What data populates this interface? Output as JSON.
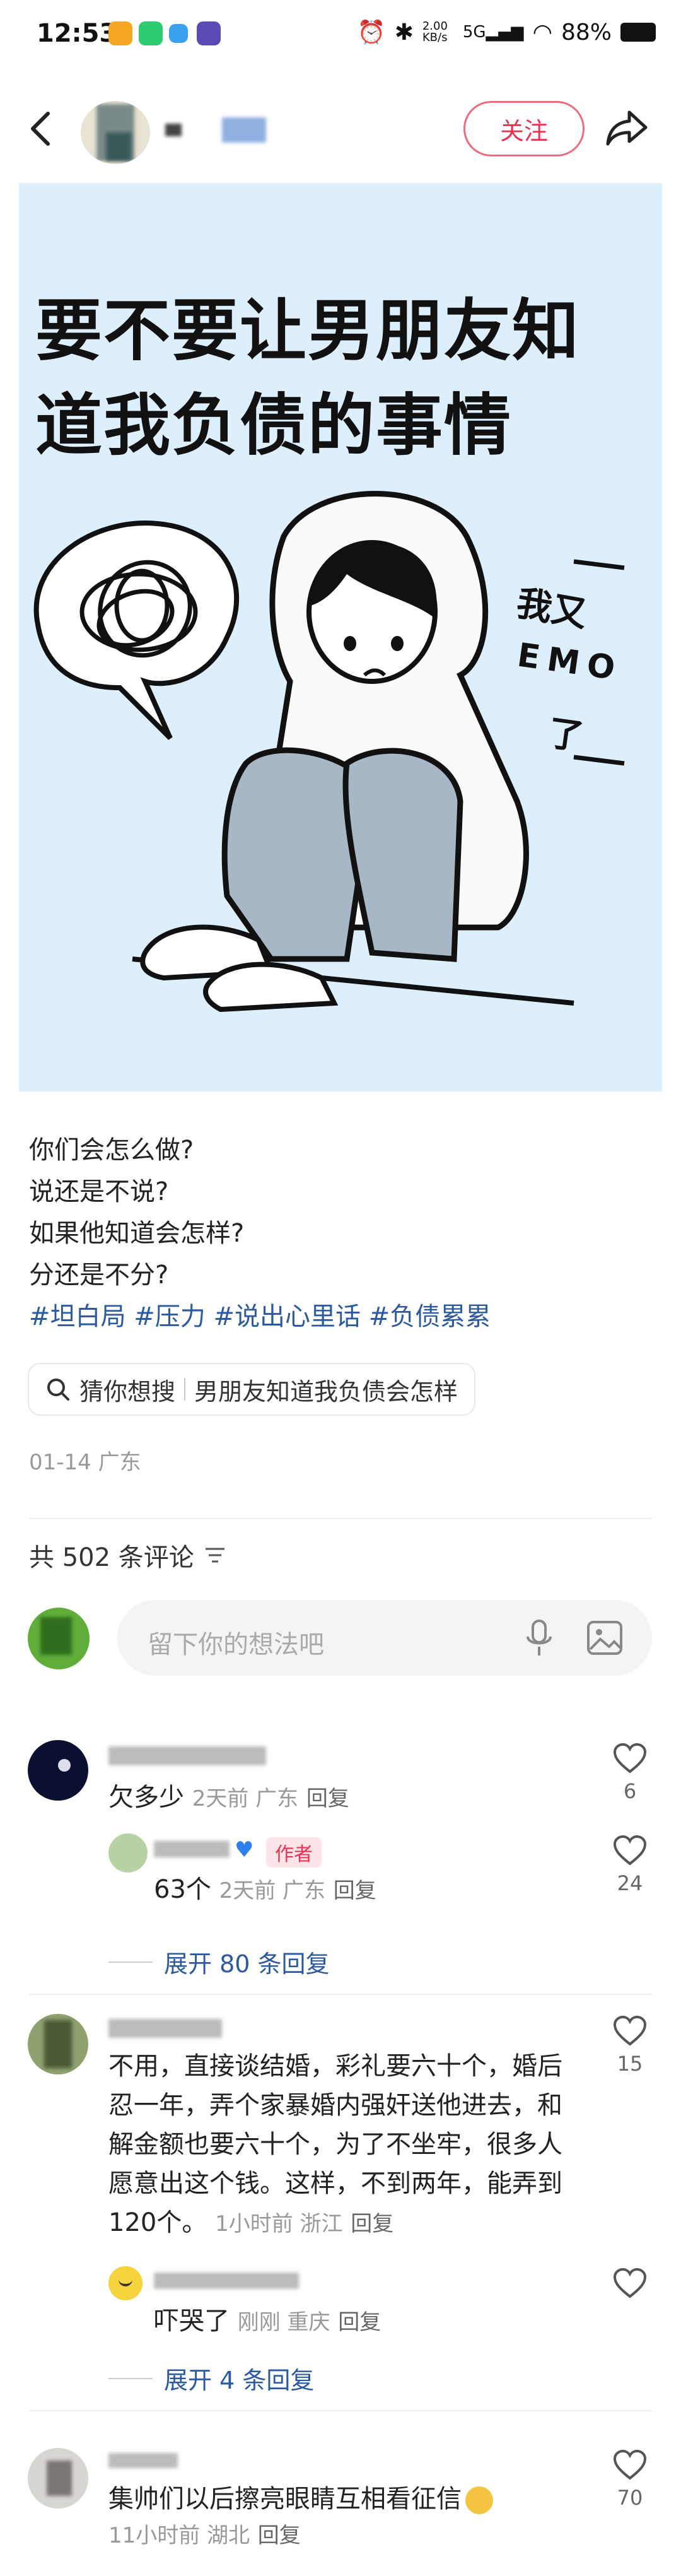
{
  "status": {
    "time": "12:53",
    "net": "2.00 KB/s",
    "sig": "5G",
    "battery": "88%"
  },
  "nav": {
    "follow_label": "关注"
  },
  "hero": {
    "line1": "要不要让男朋友知",
    "line2": "道我负债的事情",
    "bubble1": "我又",
    "bubble2": "EMO",
    "bubble3": "了"
  },
  "caption": {
    "lines": [
      "你们会怎么做?",
      "说还是不说?",
      "如果他知道会怎样?",
      "分还是不分?"
    ],
    "tags": "#坦白局 #压力 #说出心里话 #负债累累"
  },
  "guess": {
    "label": "猜你想搜",
    "query": "男朋友知道我负债会怎样"
  },
  "post_meta": {
    "date_location": "01-14 广东"
  },
  "comments_header": {
    "count_label": "共 502 条评论"
  },
  "comment_input": {
    "placeholder": "留下你的想法吧"
  },
  "comments": [
    {
      "text": "欠多少",
      "meta": "2天前 广东",
      "reply": "回复",
      "likes": "6",
      "reply_item": {
        "author_badge": "作者",
        "text": "63个",
        "meta": "2天前 广东",
        "reply": "回复",
        "likes": "24"
      },
      "expand": "展开 80 条回复"
    },
    {
      "text": "不用，直接谈结婚，彩礼要六十个，婚后忍一年，弄个家暴婚内强奸送他进去，和解金额也要六十个，为了不坐牢，很多人愿意出这个钱。这样，不到两年，能弄到120个。",
      "meta": "1小时前 浙江",
      "reply": "回复",
      "likes": "15",
      "reply_item": {
        "text": "吓哭了",
        "meta": "刚刚 重庆",
        "reply": "回复",
        "likes": ""
      },
      "expand": "展开 4 条回复"
    },
    {
      "text": "集帅们以后擦亮眼睛互相看征信",
      "meta": "11小时前 湖北",
      "reply": "回复",
      "likes": "70"
    }
  ],
  "colors": {
    "accent": "#f0304f",
    "link": "#2c5aa0",
    "hero_bg": "#ddeefc"
  }
}
